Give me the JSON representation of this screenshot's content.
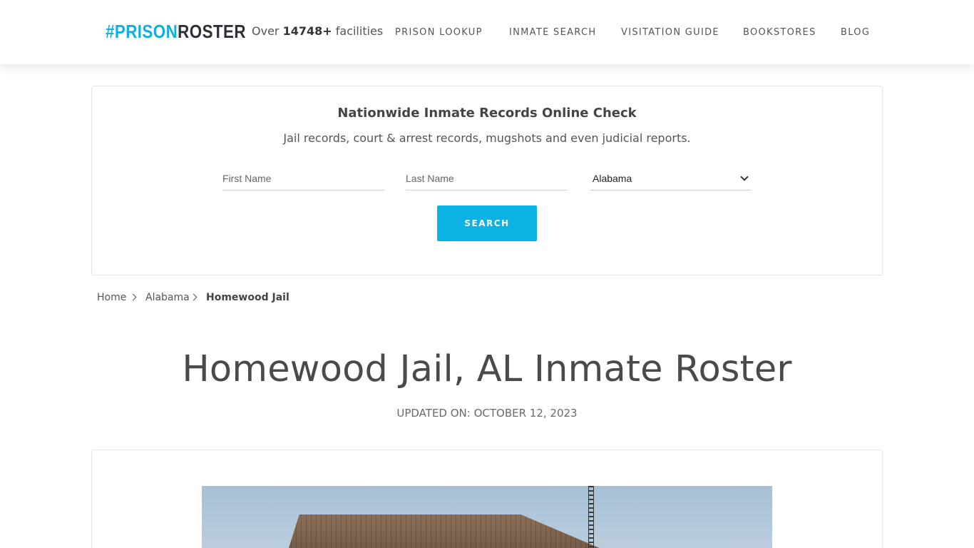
{
  "header": {
    "logo": {
      "hash": "#",
      "prison": "PRISON",
      "roster": "ROSTER"
    },
    "facilities": {
      "prefix": "Over",
      "count": "14748+",
      "suffix": "facilities"
    },
    "nav": [
      "PRISON LOOKUP",
      "INMATE SEARCH",
      "VISITATION GUIDE",
      "BOOKSTORES",
      "BLOG"
    ]
  },
  "search": {
    "title": "Nationwide Inmate Records Online Check",
    "subtitle": "Jail records, court & arrest records, mugshots and even judicial reports.",
    "first_name_placeholder": "First Name",
    "last_name_placeholder": "Last Name",
    "state_selected": "Alabama",
    "button_label": "SEARCH"
  },
  "breadcrumb": [
    "Home",
    "Alabama",
    "Homewood Jail"
  ],
  "page": {
    "title": "Homewood Jail, AL Inmate Roster",
    "updated": "UPDATED ON: OCTOBER 12, 2023"
  },
  "colors": {
    "accent": "#0bb2e4",
    "logo_dark": "#2d3038"
  }
}
